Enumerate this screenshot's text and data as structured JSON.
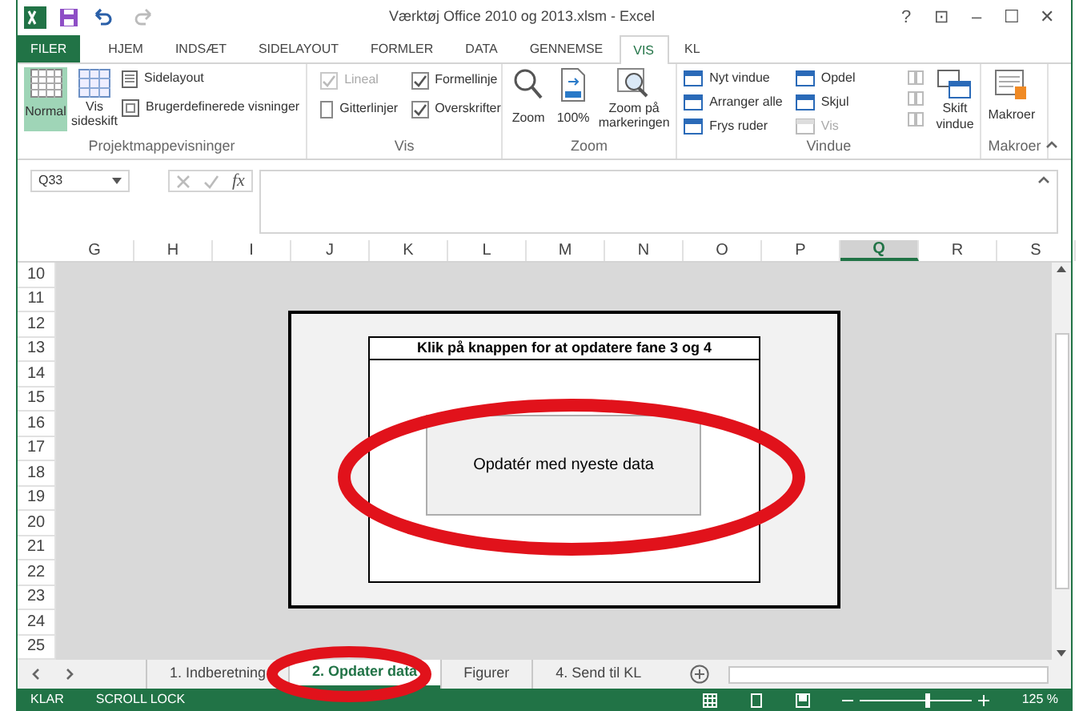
{
  "window": {
    "title": "Værktøj Office 2010 og 2013.xlsm - Excel",
    "controls": [
      "?",
      "⊡",
      "–",
      "☐",
      "✕"
    ]
  },
  "ribbon_tabs": [
    {
      "label": "FILER",
      "kind": "file",
      "selected": false
    },
    {
      "label": "HJEM",
      "kind": "tab",
      "selected": false
    },
    {
      "label": "INDSÆT",
      "kind": "tab",
      "selected": false
    },
    {
      "label": "SIDELAYOUT",
      "kind": "tab",
      "selected": false
    },
    {
      "label": "FORMLER",
      "kind": "tab",
      "selected": false
    },
    {
      "label": "DATA",
      "kind": "tab",
      "selected": false
    },
    {
      "label": "GENNEMSE",
      "kind": "tab",
      "selected": false
    },
    {
      "label": "VIS",
      "kind": "tab",
      "selected": true
    },
    {
      "label": "KL",
      "kind": "tab",
      "selected": false
    }
  ],
  "groups": {
    "views": {
      "label": "Projektmappevisninger",
      "normal": "Normal",
      "page_break": [
        "Vis",
        "sideskift"
      ],
      "page_layout": "Sidelayout",
      "custom": "Brugerdefinerede visninger"
    },
    "show": {
      "label": "Vis",
      "options": [
        {
          "label": "Lineal",
          "checked": true,
          "disabled": true
        },
        {
          "label": "Formellinje",
          "checked": true,
          "disabled": false
        },
        {
          "label": "Gitterlinjer",
          "checked": false,
          "disabled": false
        },
        {
          "label": "Overskrifter",
          "checked": true,
          "disabled": false
        }
      ]
    },
    "zoom": {
      "label": "Zoom",
      "buttons": [
        "Zoom",
        "100%"
      ],
      "selection": [
        "Zoom på",
        "markeringen"
      ]
    },
    "window": {
      "label": "Vindue",
      "items": [
        {
          "label": "Nyt vindue",
          "disabled": false
        },
        {
          "label": "Opdel",
          "disabled": false
        },
        {
          "label": "Arranger alle",
          "disabled": false
        },
        {
          "label": "Skjul",
          "disabled": false
        },
        {
          "label": "Frys ruder",
          "disabled": false
        },
        {
          "label": "Vis",
          "disabled": true
        }
      ],
      "switch": [
        "Skift",
        "vindue"
      ]
    },
    "macros": {
      "label": "Makroer",
      "button": "Makroer"
    }
  },
  "name_box": "Q33",
  "function_label": "fx",
  "columns": [
    {
      "label": "G",
      "selected": false
    },
    {
      "label": "H",
      "selected": false
    },
    {
      "label": "I",
      "selected": false
    },
    {
      "label": "J",
      "selected": false
    },
    {
      "label": "K",
      "selected": false
    },
    {
      "label": "L",
      "selected": false
    },
    {
      "label": "M",
      "selected": false
    },
    {
      "label": "N",
      "selected": false
    },
    {
      "label": "O",
      "selected": false
    },
    {
      "label": "P",
      "selected": false
    },
    {
      "label": "Q",
      "selected": true
    },
    {
      "label": "R",
      "selected": false
    },
    {
      "label": "S",
      "selected": false
    }
  ],
  "rows": [
    "10",
    "11",
    "12",
    "13",
    "14",
    "15",
    "16",
    "17",
    "18",
    "19",
    "20",
    "21",
    "22",
    "23",
    "24",
    "25"
  ],
  "panel": {
    "title": "Klik på knappen for at opdatere fane 3 og 4",
    "button": "Opdatér med nyeste data"
  },
  "sheet_tabs": [
    {
      "label": "1. Indberetning",
      "selected": false
    },
    {
      "label": "2. Opdater data",
      "selected": true
    },
    {
      "label": "Figurer",
      "selected": false
    },
    {
      "label": "4. Send til KL",
      "selected": false
    }
  ],
  "status_bar": {
    "items": [
      "KLAR",
      "SCROLL LOCK"
    ],
    "zoom": "125 %",
    "level": 0.6
  }
}
